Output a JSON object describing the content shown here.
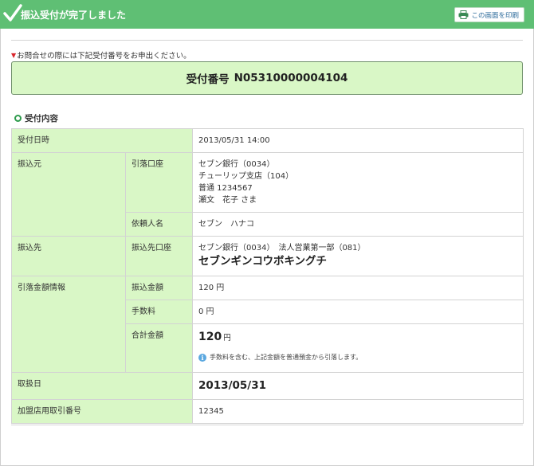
{
  "header": {
    "title": "振込受付が完了しました",
    "print_label": "この画面を印刷"
  },
  "notice": {
    "text": "お問合せの際には下記受付番号をお申出ください。"
  },
  "receipt": {
    "label": "受付番号",
    "number": "N05310000004104"
  },
  "section": {
    "title": "受付内容"
  },
  "details": {
    "reception_datetime": {
      "label": "受付日時",
      "value": "2013/05/31 14:00"
    },
    "source": {
      "label": "振込元",
      "account_label": "引落口座",
      "account_lines": [
        "セブン銀行（0034）",
        "チューリップ支店（104）",
        "普通 1234567",
        "瀬文　花子 さま"
      ],
      "requester_label": "依頼人名",
      "requester_value": "セブン　ハナコ"
    },
    "destination": {
      "label": "振込先",
      "account_label": "振込先口座",
      "bank_line": "セブン銀行（0034）　法人営業第一部（081）",
      "account_name": "セブンギンコウボキングチ"
    },
    "amount": {
      "label": "引落金額情報",
      "transfer_label": "振込金額",
      "transfer_value": "120 円",
      "fee_label": "手数料",
      "fee_value": "0 円",
      "total_label": "合計金額",
      "total_value": "120",
      "total_unit": "円",
      "info_icon": "info-icon",
      "info_text": "手数料を含む、上記金額を普通預金から引落します。"
    },
    "transaction_date": {
      "label": "取扱日",
      "value": "2013/05/31"
    },
    "merchant_ref": {
      "label": "加盟店用取引番号",
      "value": "12345"
    }
  },
  "colors": {
    "header_bg": "#5fbf74",
    "label_bg": "#d9f7c6",
    "accent_green": "#2e9b4c",
    "notice_red": "#d9262c",
    "info_blue": "#5ba8e0"
  },
  "icons": {
    "header": "check-icon",
    "print": "printer-icon",
    "notice": "triangle-down-icon",
    "section": "circle-icon"
  }
}
